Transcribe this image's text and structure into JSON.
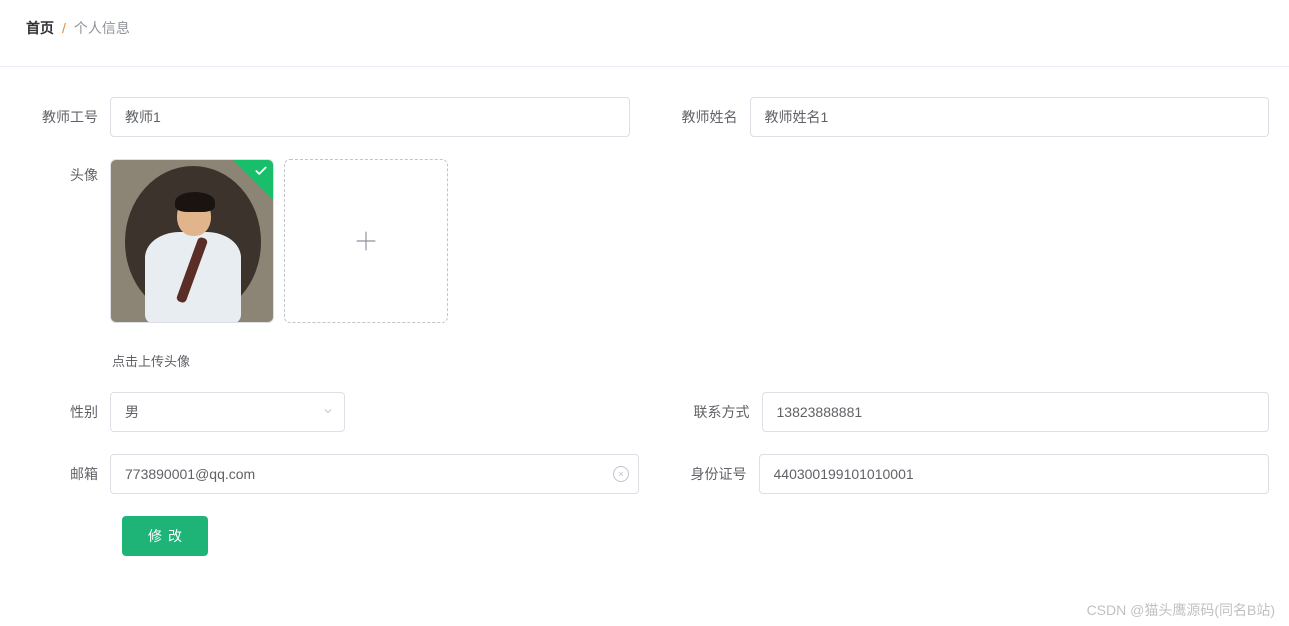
{
  "breadcrumb": {
    "home": "首页",
    "separator": "/",
    "current": "个人信息"
  },
  "form": {
    "teacher_id": {
      "label": "教师工号",
      "value": "教师1"
    },
    "teacher_name": {
      "label": "教师姓名",
      "value": "教师姓名1"
    },
    "avatar": {
      "label": "头像",
      "hint": "点击上传头像"
    },
    "gender": {
      "label": "性别",
      "value": "男"
    },
    "contact": {
      "label": "联系方式",
      "value": "13823888881"
    },
    "email": {
      "label": "邮箱",
      "value": "773890001@qq.com"
    },
    "id_number": {
      "label": "身份证号",
      "value": "440300199101010001"
    }
  },
  "buttons": {
    "submit": "修改"
  },
  "watermark": "CSDN @猫头鹰源码(同名B站)"
}
